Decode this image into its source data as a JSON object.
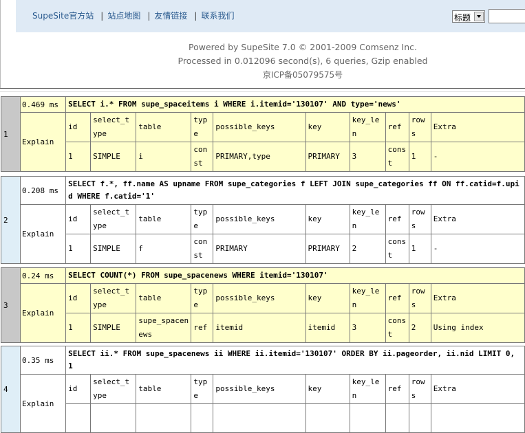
{
  "nav": {
    "links": [
      "SupeSite官方站",
      "站点地图",
      "友情链接",
      "联系我们"
    ],
    "search_select": "标题"
  },
  "footer": {
    "powered": "Powered by SupeSite 7.0 © 2001-2009 Comsenz Inc.",
    "processed": "Processed in 0.012096 second(s), 6 queries, Gzip enabled",
    "icp": "京ICP备05079575号"
  },
  "columns": [
    "id",
    "select_type",
    "table",
    "type",
    "possible_keys",
    "key",
    "key_len",
    "ref",
    "rows",
    "Extra"
  ],
  "explain_label": "Explain",
  "queries": [
    {
      "num": "1",
      "time": "0.469 ms",
      "sql": "SELECT i.* FROM supe_spaceitems i WHERE i.itemid='130107' AND type='news'",
      "row": [
        "1",
        "SIMPLE",
        "i",
        "const",
        "PRIMARY,type",
        "PRIMARY",
        "3",
        "const",
        "1",
        "-"
      ]
    },
    {
      "num": "2",
      "time": "0.208 ms",
      "sql": "SELECT f.*, ff.name AS upname FROM supe_categories f LEFT JOIN supe_categories ff ON ff.catid=f.upid WHERE f.catid='1'",
      "row": [
        "1",
        "SIMPLE",
        "f",
        "const",
        "PRIMARY",
        "PRIMARY",
        "2",
        "const",
        "1",
        "-"
      ]
    },
    {
      "num": "3",
      "time": "0.24 ms",
      "sql": "SELECT COUNT(*) FROM supe_spacenews WHERE itemid='130107'",
      "row": [
        "1",
        "SIMPLE",
        "supe_spacenews",
        "ref",
        "itemid",
        "itemid",
        "3",
        "const",
        "2",
        "Using index"
      ]
    },
    {
      "num": "4",
      "time": "0.35 ms",
      "sql": "SELECT ii.* FROM supe_spacenews ii WHERE ii.itemid='130107' ORDER BY ii.pageorder, ii.nid LIMIT 0, 1",
      "row": []
    }
  ]
}
